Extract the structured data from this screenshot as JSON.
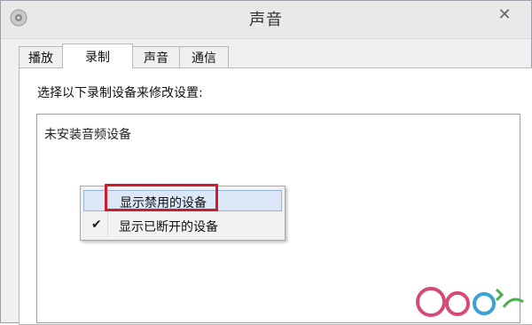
{
  "window": {
    "title": "声音",
    "close_glyph": "✕"
  },
  "tabs": [
    {
      "label": "播放",
      "active": false
    },
    {
      "label": "录制",
      "active": true
    },
    {
      "label": "声音",
      "active": false
    },
    {
      "label": "通信",
      "active": false
    }
  ],
  "recording": {
    "instruction": "选择以下录制设备来修改设置:",
    "empty_message": "未安装音频设备"
  },
  "context_menu": {
    "items": [
      {
        "label": "显示禁用的设备",
        "checked": false,
        "highlighted": true
      },
      {
        "label": "显示已断开的设备",
        "checked": true,
        "highlighted": false
      }
    ],
    "check_glyph": "✔"
  },
  "icons": {
    "app": "speaker-icon",
    "close": "close-icon",
    "check": "check-icon",
    "watermark": "site-logo-watermark"
  },
  "colors": {
    "highlight_box": "#d11a2a",
    "menu_hover_bg": "#dce8f7",
    "menu_hover_border": "#99b4dc"
  }
}
